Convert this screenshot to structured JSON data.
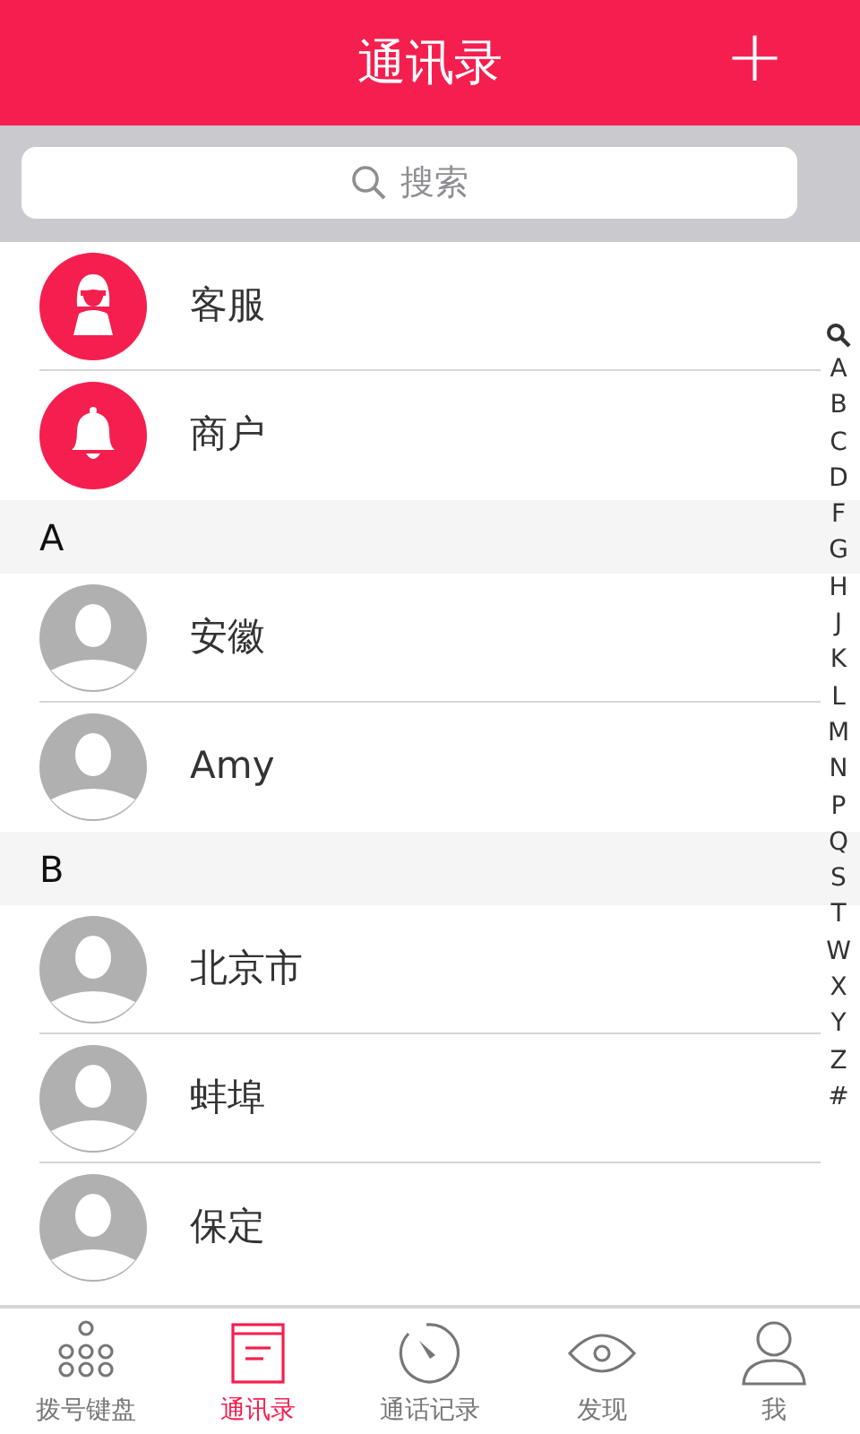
{
  "header": {
    "title": "通讯录",
    "add_button": "+"
  },
  "search": {
    "placeholder": "搜索"
  },
  "sections": [
    {
      "contacts": [
        {
          "name": "客服",
          "kind": "service"
        },
        {
          "name": "商户",
          "kind": "merchant"
        }
      ]
    },
    {
      "letter": "A",
      "contacts": [
        {
          "name": "安徽",
          "kind": "person"
        },
        {
          "name": "Amy",
          "kind": "person"
        }
      ]
    },
    {
      "letter": "B",
      "contacts": [
        {
          "name": "北京市",
          "kind": "person"
        },
        {
          "name": "蚌埠",
          "kind": "person"
        },
        {
          "name": "保定",
          "kind": "person"
        }
      ]
    }
  ],
  "index": [
    "A",
    "B",
    "C",
    "D",
    "F",
    "G",
    "H",
    "J",
    "K",
    "L",
    "M",
    "N",
    "P",
    "Q",
    "S",
    "T",
    "W",
    "X",
    "Y",
    "Z",
    "#"
  ],
  "tabs": [
    {
      "label": "拨号键盘",
      "kind": "keypad",
      "selected": false
    },
    {
      "label": "通讯录",
      "kind": "contacts",
      "selected": true
    },
    {
      "label": "通话记录",
      "kind": "history",
      "selected": false
    },
    {
      "label": "发现",
      "kind": "discover",
      "selected": false
    },
    {
      "label": "我",
      "kind": "me",
      "selected": false
    }
  ]
}
